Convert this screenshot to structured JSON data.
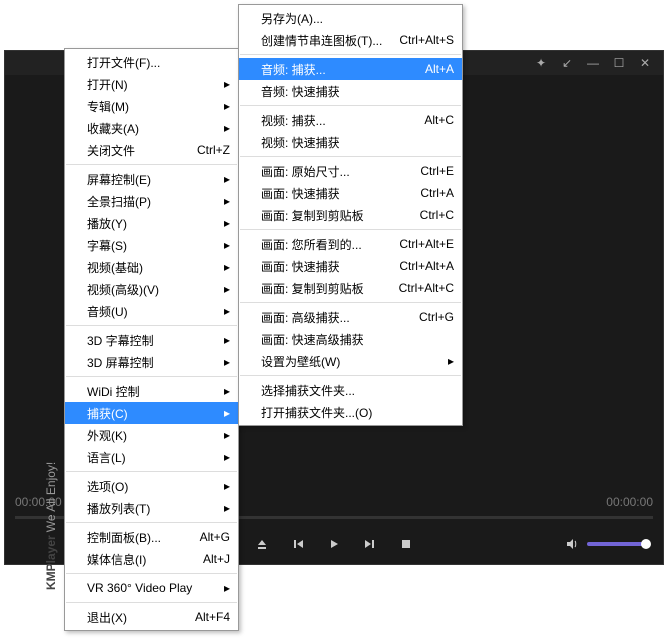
{
  "player": {
    "time_left": "00:00:00",
    "time_right": "00:00:00",
    "brand_strong": "KMPlayer",
    "brand_weak": "We All Enjoy!"
  },
  "menu1": {
    "groups": [
      [
        {
          "label": "打开文件(F)...",
          "shortcut": "",
          "arrow": false
        },
        {
          "label": "打开(N)",
          "shortcut": "",
          "arrow": true
        },
        {
          "label": "专辑(M)",
          "shortcut": "",
          "arrow": true
        },
        {
          "label": "收藏夹(A)",
          "shortcut": "",
          "arrow": true
        },
        {
          "label": "关闭文件",
          "shortcut": "Ctrl+Z",
          "arrow": false
        }
      ],
      [
        {
          "label": "屏幕控制(E)",
          "shortcut": "",
          "arrow": true
        },
        {
          "label": "全景扫描(P)",
          "shortcut": "",
          "arrow": true
        },
        {
          "label": "播放(Y)",
          "shortcut": "",
          "arrow": true
        },
        {
          "label": "字幕(S)",
          "shortcut": "",
          "arrow": true
        },
        {
          "label": "视频(基础)",
          "shortcut": "",
          "arrow": true
        },
        {
          "label": "视频(高级)(V)",
          "shortcut": "",
          "arrow": true
        },
        {
          "label": "音频(U)",
          "shortcut": "",
          "arrow": true
        }
      ],
      [
        {
          "label": "3D 字幕控制",
          "shortcut": "",
          "arrow": true
        },
        {
          "label": "3D 屏幕控制",
          "shortcut": "",
          "arrow": true
        }
      ],
      [
        {
          "label": "WiDi 控制",
          "shortcut": "",
          "arrow": true
        },
        {
          "label": "捕获(C)",
          "shortcut": "",
          "arrow": true,
          "selected": true
        },
        {
          "label": "外观(K)",
          "shortcut": "",
          "arrow": true
        },
        {
          "label": "语言(L)",
          "shortcut": "",
          "arrow": true
        }
      ],
      [
        {
          "label": "选项(O)",
          "shortcut": "",
          "arrow": true
        },
        {
          "label": "播放列表(T)",
          "shortcut": "",
          "arrow": true
        }
      ],
      [
        {
          "label": "控制面板(B)...",
          "shortcut": "Alt+G",
          "arrow": false
        },
        {
          "label": "媒体信息(I)",
          "shortcut": "Alt+J",
          "arrow": false
        }
      ],
      [
        {
          "label": "VR 360° Video Play",
          "shortcut": "",
          "arrow": true
        }
      ],
      [
        {
          "label": "退出(X)",
          "shortcut": "Alt+F4",
          "arrow": false
        }
      ]
    ]
  },
  "menu2": {
    "groups": [
      [
        {
          "label": "另存为(A)...",
          "shortcut": "",
          "arrow": false
        },
        {
          "label": "创建情节串连图板(T)...",
          "shortcut": "Ctrl+Alt+S",
          "arrow": false
        }
      ],
      [
        {
          "label": "音频: 捕获...",
          "shortcut": "Alt+A",
          "arrow": false,
          "selected": true
        },
        {
          "label": "音频: 快速捕获",
          "shortcut": "",
          "arrow": false
        }
      ],
      [
        {
          "label": "视频: 捕获...",
          "shortcut": "Alt+C",
          "arrow": false
        },
        {
          "label": "视频: 快速捕获",
          "shortcut": "",
          "arrow": false
        }
      ],
      [
        {
          "label": "画面: 原始尺寸...",
          "shortcut": "Ctrl+E",
          "arrow": false
        },
        {
          "label": "画面: 快速捕获",
          "shortcut": "Ctrl+A",
          "arrow": false
        },
        {
          "label": "画面: 复制到剪贴板",
          "shortcut": "Ctrl+C",
          "arrow": false
        }
      ],
      [
        {
          "label": "画面: 您所看到的...",
          "shortcut": "Ctrl+Alt+E",
          "arrow": false
        },
        {
          "label": "画面: 快速捕获",
          "shortcut": "Ctrl+Alt+A",
          "arrow": false
        },
        {
          "label": "画面: 复制到剪贴板",
          "shortcut": "Ctrl+Alt+C",
          "arrow": false
        }
      ],
      [
        {
          "label": "画面: 高级捕获...",
          "shortcut": "Ctrl+G",
          "arrow": false
        },
        {
          "label": "画面: 快速高级捕获",
          "shortcut": "",
          "arrow": false
        },
        {
          "label": "设置为壁纸(W)",
          "shortcut": "",
          "arrow": true
        }
      ],
      [
        {
          "label": "选择捕获文件夹...",
          "shortcut": "",
          "arrow": false
        },
        {
          "label": "打开捕获文件夹...(O)",
          "shortcut": "",
          "arrow": false
        }
      ]
    ]
  }
}
